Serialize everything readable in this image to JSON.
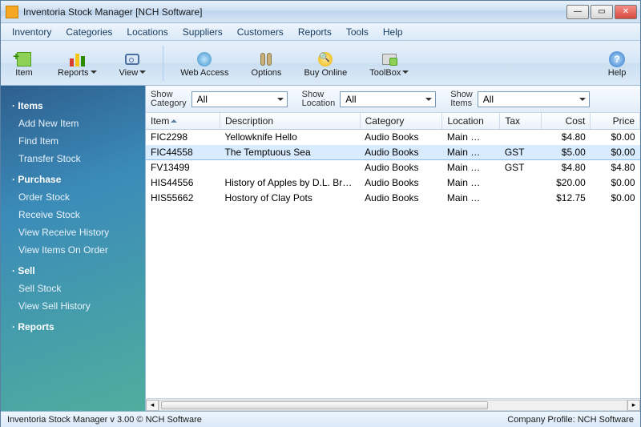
{
  "window": {
    "title": "Inventoria Stock Manager [NCH Software]"
  },
  "menubar": [
    "Inventory",
    "Categories",
    "Locations",
    "Suppliers",
    "Customers",
    "Reports",
    "Tools",
    "Help"
  ],
  "toolbar": {
    "item": "Item",
    "reports": "Reports",
    "view": "View",
    "web": "Web Access",
    "options": "Options",
    "buy": "Buy Online",
    "toolbox": "ToolBox",
    "help": "Help"
  },
  "sidebar": {
    "groups": [
      {
        "title": "Items",
        "items": [
          "Add New Item",
          "Find Item",
          "Transfer Stock"
        ]
      },
      {
        "title": "Purchase",
        "items": [
          "Order Stock",
          "Receive Stock",
          "View Receive History",
          "View Items On Order"
        ]
      },
      {
        "title": "Sell",
        "items": [
          "Sell Stock",
          "View Sell History"
        ]
      },
      {
        "title": "Reports",
        "items": []
      }
    ]
  },
  "filters": {
    "category_label": "Show\nCategory",
    "category_value": "All",
    "location_label": "Show\nLocation",
    "location_value": "All",
    "items_label": "Show\nItems",
    "items_value": "All"
  },
  "columns": [
    "Item",
    "Description",
    "Category",
    "Location",
    "Tax",
    "Cost",
    "Price"
  ],
  "rows": [
    {
      "item": "FIC2298",
      "desc": "Yellowknife Hello",
      "cat": "Audio Books",
      "loc": "Main …",
      "tax": "",
      "cost": "$4.80",
      "price": "$0.00",
      "sel": false
    },
    {
      "item": "FIC44558",
      "desc": "The Temptuous Sea",
      "cat": "Audio Books",
      "loc": "Main …",
      "tax": "GST",
      "cost": "$5.00",
      "price": "$0.00",
      "sel": true
    },
    {
      "item": "FV13499",
      "desc": "",
      "cat": "Audio Books",
      "loc": "Main …",
      "tax": "GST",
      "cost": "$4.80",
      "price": "$4.80",
      "sel": false
    },
    {
      "item": "HIS44556",
      "desc": "History of Apples by D.L. Brewer",
      "cat": "Audio Books",
      "loc": "Main …",
      "tax": "",
      "cost": "$20.00",
      "price": "$0.00",
      "sel": false
    },
    {
      "item": "HIS55662",
      "desc": "Hostory of Clay Pots",
      "cat": "Audio Books",
      "loc": "Main …",
      "tax": "",
      "cost": "$12.75",
      "price": "$0.00",
      "sel": false
    }
  ],
  "status": {
    "left": "Inventoria Stock Manager v 3.00 © NCH Software",
    "right": "Company Profile: NCH Software"
  }
}
